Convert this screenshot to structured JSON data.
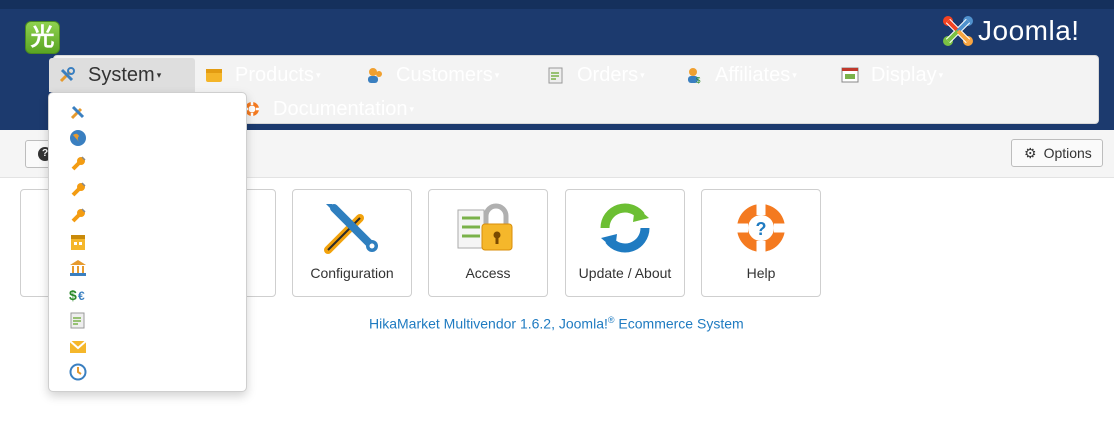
{
  "header": {
    "joomla_wordmark": "Joomla!"
  },
  "nav": {
    "items": [
      {
        "label": "System",
        "icon": "tools-icon",
        "active": true
      },
      {
        "label": "Products",
        "icon": "box-icon"
      },
      {
        "label": "Customers",
        "icon": "users-icon"
      },
      {
        "label": "Orders",
        "icon": "order-icon"
      },
      {
        "label": "Affiliates",
        "icon": "affiliate-icon"
      },
      {
        "label": "Display",
        "icon": "display-icon"
      },
      {
        "label": "Documentation",
        "icon": "lifebuoy-icon"
      }
    ]
  },
  "dropdown": {
    "icons": [
      "tools-icon",
      "globe-icon",
      "plugin-icon",
      "plugin-icon",
      "plugin-icon",
      "calendar-icon",
      "bank-icon",
      "currency-icon",
      "order-icon",
      "email-icon",
      "history-icon"
    ]
  },
  "toolbar": {
    "options_label": "Options",
    "help_icon": "help-icon"
  },
  "tiles": [
    {
      "label": "Configuration",
      "icon": "configuration-icon"
    },
    {
      "label": "Access",
      "icon": "access-icon"
    },
    {
      "label": "Update / About",
      "icon": "update-icon"
    },
    {
      "label": "Help",
      "icon": "lifebuoy-icon"
    }
  ],
  "footer": {
    "text_before": "HikaMarket Multivendor 1.6.2, Joomla!",
    "registered": "®",
    "text_after": " Ecommerce System"
  },
  "colors": {
    "header_bg": "#1c3a6e",
    "link": "#1f7bc1",
    "logo_green": "#6cbf33"
  }
}
